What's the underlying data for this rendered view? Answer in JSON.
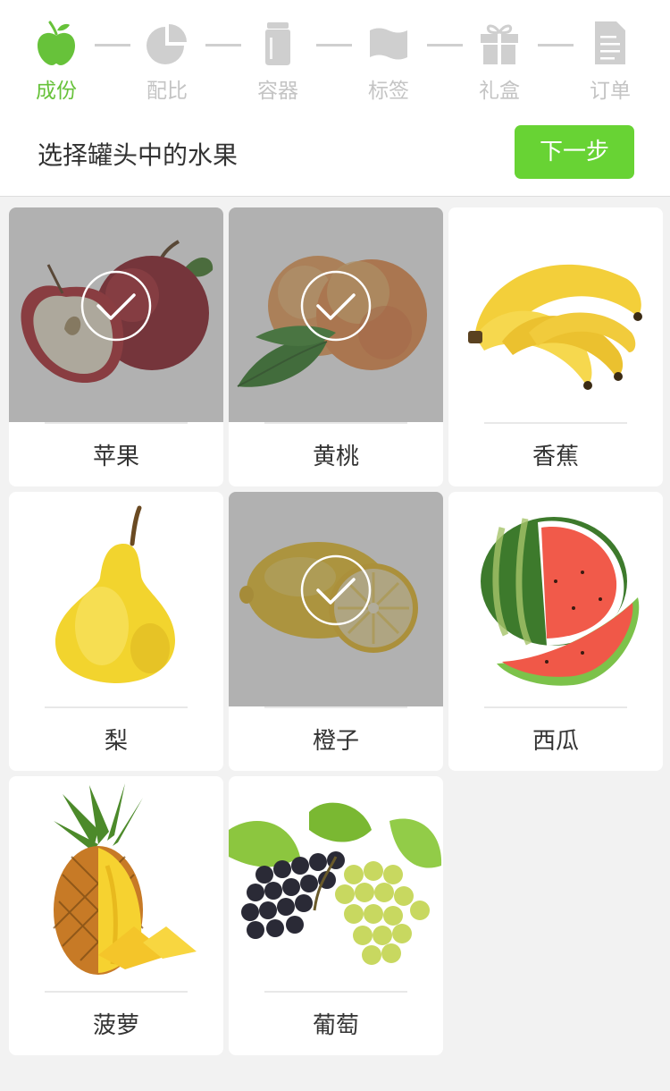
{
  "steps": [
    {
      "label": "成份",
      "icon": "apple-icon",
      "active": true
    },
    {
      "label": "配比",
      "icon": "pie-chart-icon",
      "active": false
    },
    {
      "label": "容器",
      "icon": "jar-icon",
      "active": false
    },
    {
      "label": "标签",
      "icon": "flag-icon",
      "active": false
    },
    {
      "label": "礼盒",
      "icon": "gift-box-icon",
      "active": false
    },
    {
      "label": "订单",
      "icon": "document-icon",
      "active": false
    }
  ],
  "subheader": {
    "title": "选择罐头中的水果",
    "next_label": "下一步"
  },
  "fruits": [
    {
      "name": "苹果",
      "selected": true
    },
    {
      "name": "黄桃",
      "selected": true
    },
    {
      "name": "香蕉",
      "selected": false
    },
    {
      "name": "梨",
      "selected": false
    },
    {
      "name": "橙子",
      "selected": true
    },
    {
      "name": "西瓜",
      "selected": false
    },
    {
      "name": "菠萝",
      "selected": false
    },
    {
      "name": "葡萄",
      "selected": false
    }
  ],
  "colors": {
    "accent": "#68d334",
    "active_step": "#67c23a",
    "inactive": "#c4c4c4",
    "background": "#f2f2f2"
  }
}
